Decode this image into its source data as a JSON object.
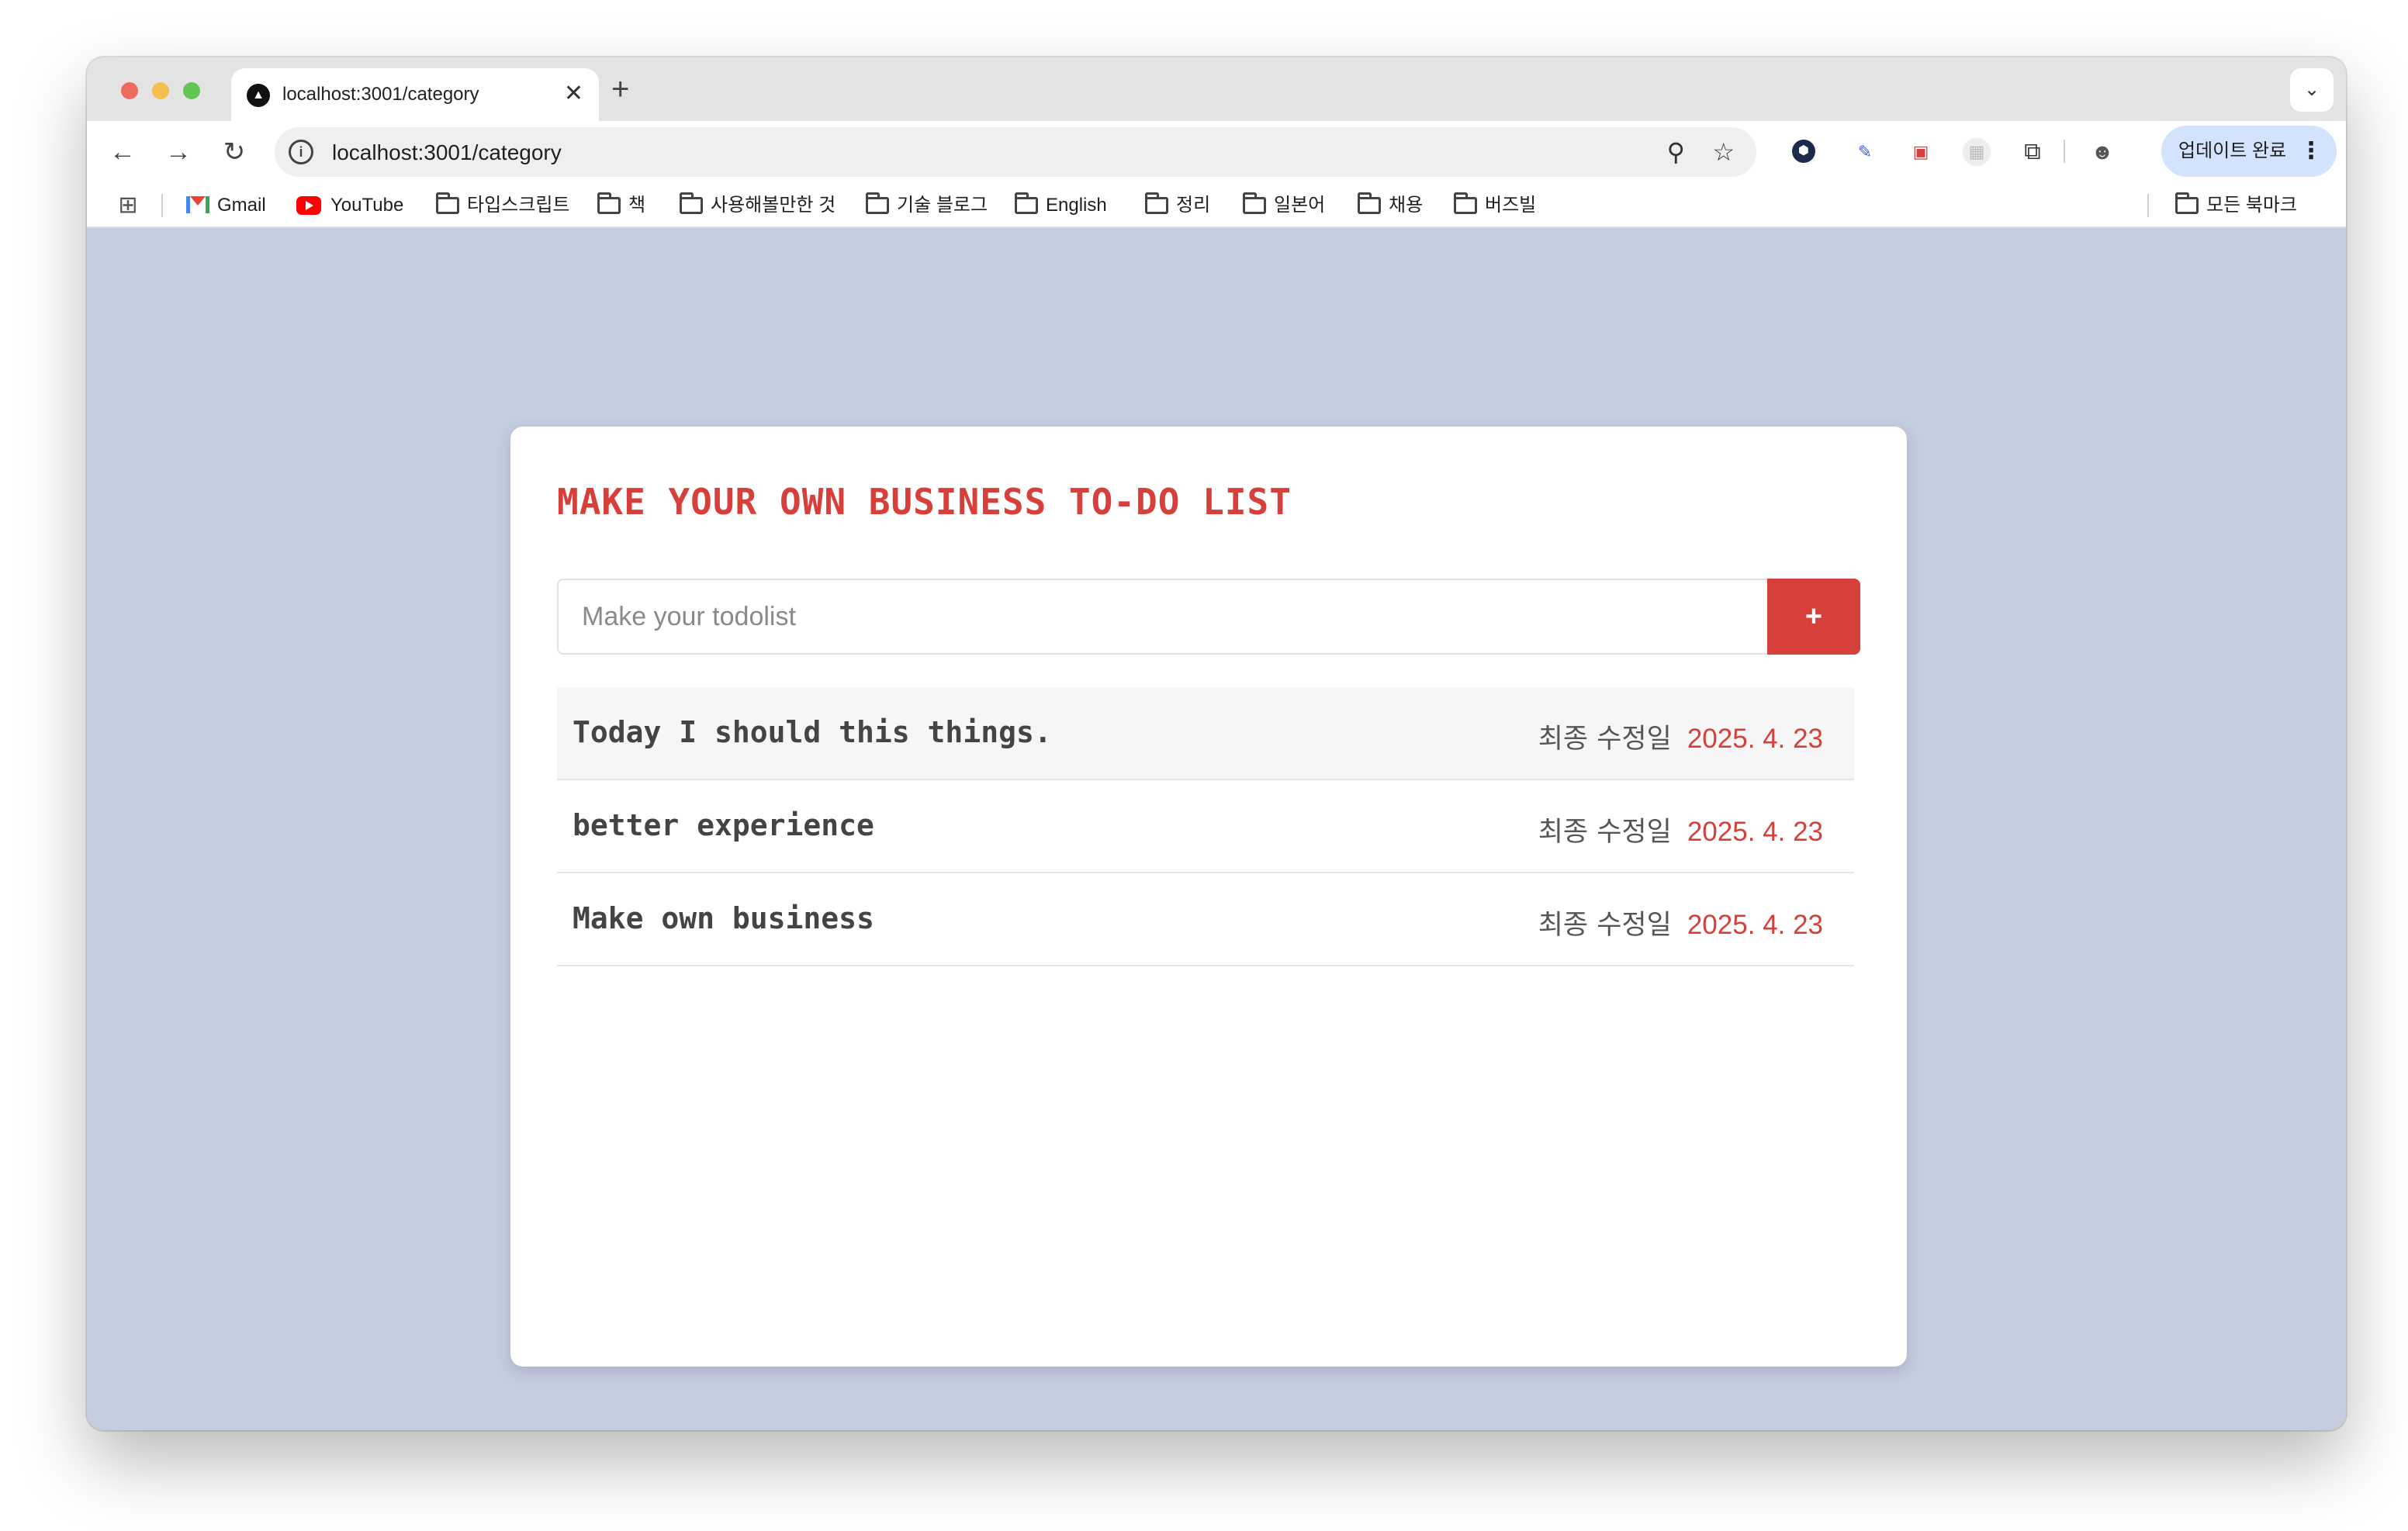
{
  "browser": {
    "tab": {
      "title": "localhost:3001/category",
      "close": "✕"
    },
    "new_tab": "+",
    "tab_list": "⌄",
    "nav": {
      "back": "←",
      "forward": "→",
      "reload": "↻"
    },
    "omnibox": {
      "url": "localhost:3001/category"
    },
    "update_button": {
      "label": "업데이트 완료",
      "menu": "⋮"
    }
  },
  "bookmarks": {
    "items": [
      {
        "label": "Gmail",
        "icon": "gmail-icon"
      },
      {
        "label": "YouTube",
        "icon": "youtube-icon"
      },
      {
        "label": "타입스크립트",
        "icon": "folder-icon"
      },
      {
        "label": "책",
        "icon": "folder-icon"
      },
      {
        "label": "사용해볼만한 것",
        "icon": "folder-icon"
      },
      {
        "label": "기술 블로그",
        "icon": "folder-icon"
      },
      {
        "label": "English",
        "icon": "folder-icon"
      },
      {
        "label": "정리",
        "icon": "folder-icon"
      },
      {
        "label": "일본어",
        "icon": "folder-icon"
      },
      {
        "label": "채용",
        "icon": "folder-icon"
      },
      {
        "label": "버즈빌",
        "icon": "folder-icon"
      }
    ],
    "all_bookmarks": {
      "label": "모든 북마크",
      "icon": "folder-icon"
    }
  },
  "app": {
    "title": "MAKE YOUR OWN BUSINESS TO-DO LIST",
    "input": {
      "placeholder": "Make your todolist",
      "value": ""
    },
    "add_button": "+",
    "todos": [
      {
        "text": "Today I should this things.",
        "meta_label": "최종 수정일",
        "date": "2025. 4. 23"
      },
      {
        "text": "better experience",
        "meta_label": "최종 수정일",
        "date": "2025. 4. 23"
      },
      {
        "text": "Make own business",
        "meta_label": "최종 수정일",
        "date": "2025. 4. 23"
      }
    ]
  },
  "colors": {
    "accent": "#d7403a",
    "page_background": "#c5cde0",
    "card_background": "#ffffff"
  }
}
